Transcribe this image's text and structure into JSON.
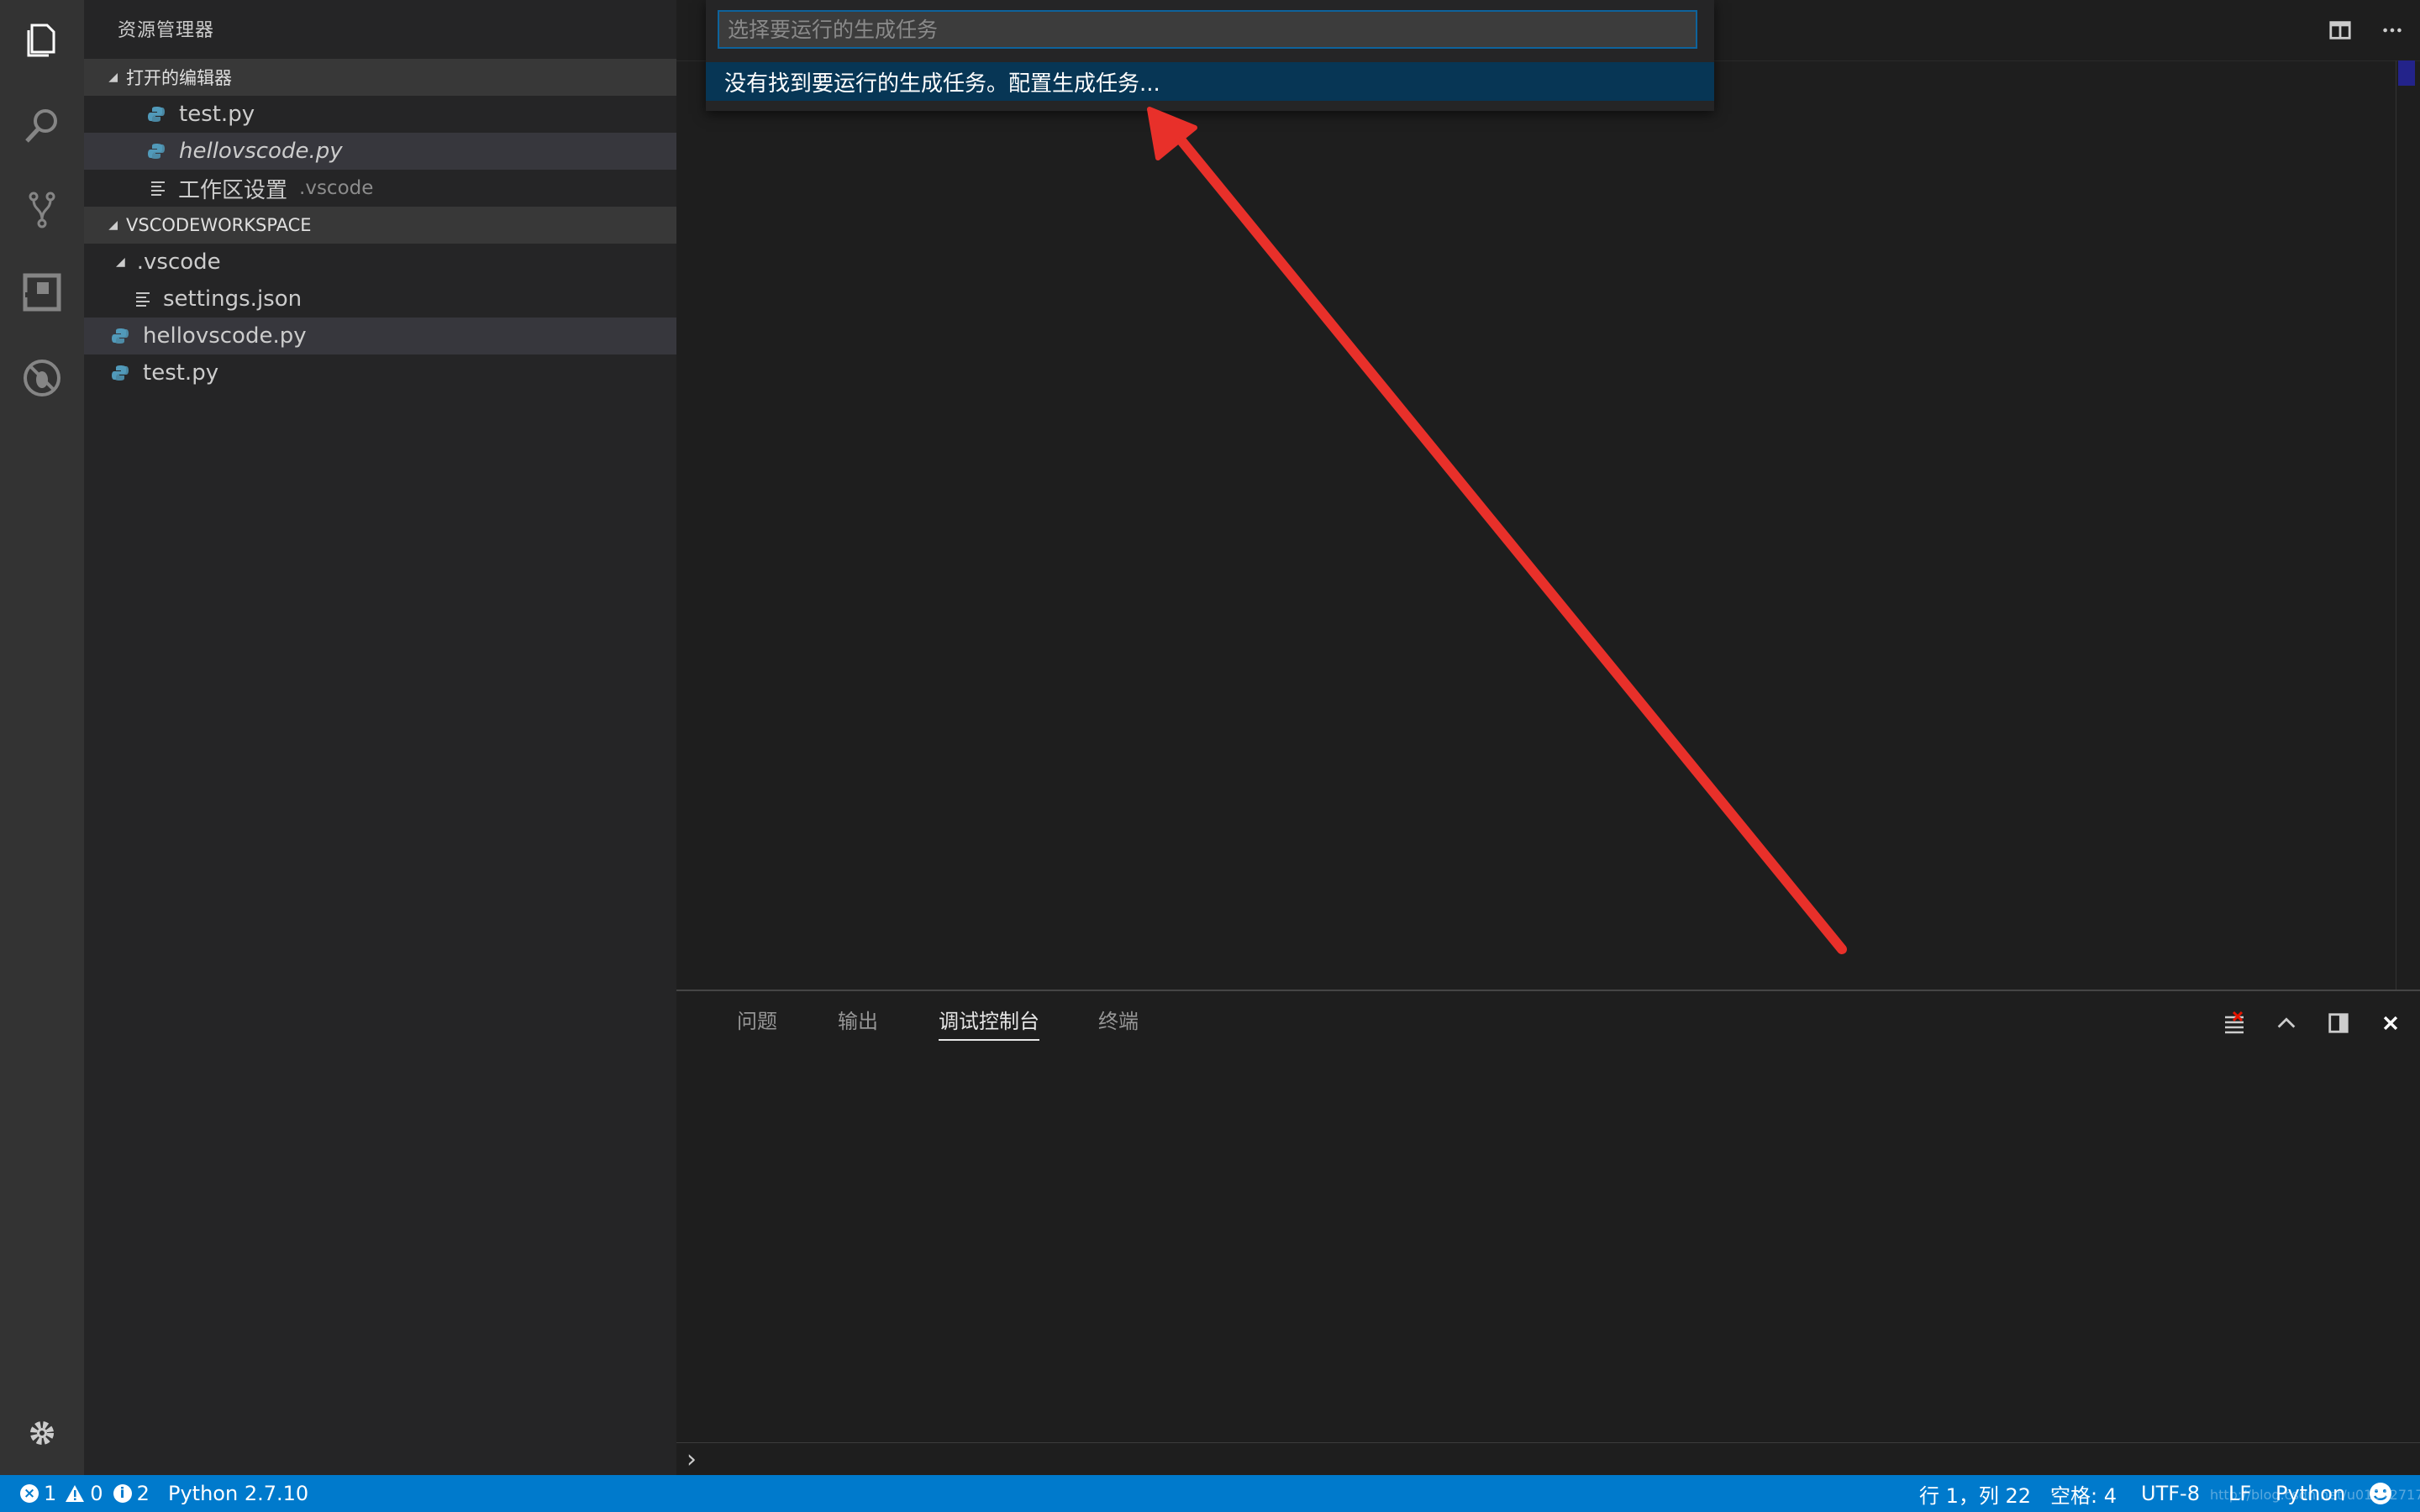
{
  "activity_bar": {
    "icons": [
      "explorer-icon",
      "search-icon",
      "source-control-icon",
      "extensions-icon",
      "debug-icon"
    ],
    "bottom_icon": "gear-icon"
  },
  "sidebar": {
    "title": "资源管理器",
    "open_editors": {
      "header": "打开的编辑器",
      "items": [
        {
          "label": "test.py",
          "hint": ""
        },
        {
          "label": "hellovscode.py",
          "hint": ""
        },
        {
          "label": "工作区设置",
          "hint": ".vscode"
        }
      ]
    },
    "workspace": {
      "header": "VSCODEWORKSPACE",
      "items": [
        {
          "label": ".vscode"
        },
        {
          "label": "settings.json"
        },
        {
          "label": "hellovscode.py"
        },
        {
          "label": "test.py"
        }
      ]
    }
  },
  "quick_pick": {
    "placeholder": "选择要运行的生成任务",
    "value": "",
    "item": "没有找到要运行的生成任务。配置生成任务..."
  },
  "panel": {
    "tabs": [
      "问题",
      "输出",
      "调试控制台",
      "终端"
    ],
    "active_tab": "调试控制台"
  },
  "status_bar": {
    "errors": "1",
    "warnings": "0",
    "infos": "2",
    "interpreter": "Python 2.7.10",
    "position": "行 1，列 22",
    "spaces": "空格: 4",
    "encoding": "UTF-8",
    "eol": "LF",
    "language": "Python",
    "watermark": "http://blog.csdn.net/u013427177"
  },
  "colors": {
    "status_bar": "#007acc",
    "quick_pick_selection": "#073655",
    "annotation_arrow": "#e8302a"
  }
}
